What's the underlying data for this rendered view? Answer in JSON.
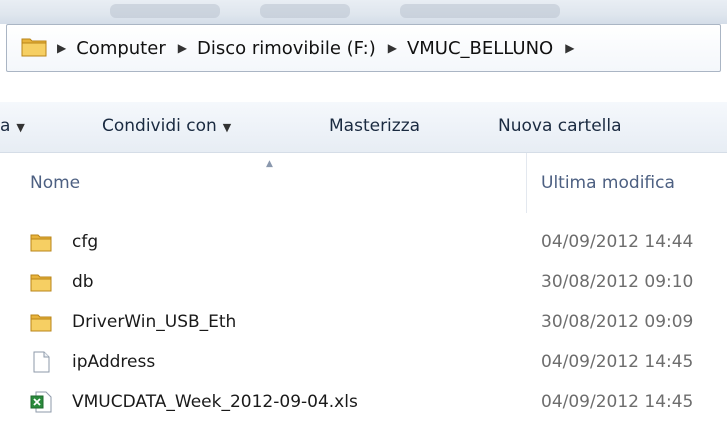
{
  "address": {
    "crumbs": [
      "Computer",
      "Disco rimovibile (F:)",
      "VMUC_BELLUNO"
    ]
  },
  "toolbar": {
    "partial_label": "a",
    "share_label": "Condividi con",
    "burn_label": "Masterizza",
    "new_folder_label": "Nuova cartella"
  },
  "columns": {
    "name": "Nome",
    "modified": "Ultima modifica"
  },
  "files": [
    {
      "name": "cfg",
      "modified": "04/09/2012 14:44",
      "icon": "folder-icon"
    },
    {
      "name": "db",
      "modified": "30/08/2012 09:10",
      "icon": "folder-icon"
    },
    {
      "name": "DriverWin_USB_Eth",
      "modified": "30/08/2012 09:09",
      "icon": "folder-icon"
    },
    {
      "name": "ipAddress",
      "modified": "04/09/2012 14:45",
      "icon": "file-icon"
    },
    {
      "name": "VMUCDATA_Week_2012-09-04.xls",
      "modified": "04/09/2012 14:45",
      "icon": "excel-file-icon"
    }
  ],
  "colors": {
    "folder": "#e8b33c",
    "header_text": "#4d6082",
    "date_text": "#6d6d6d"
  }
}
